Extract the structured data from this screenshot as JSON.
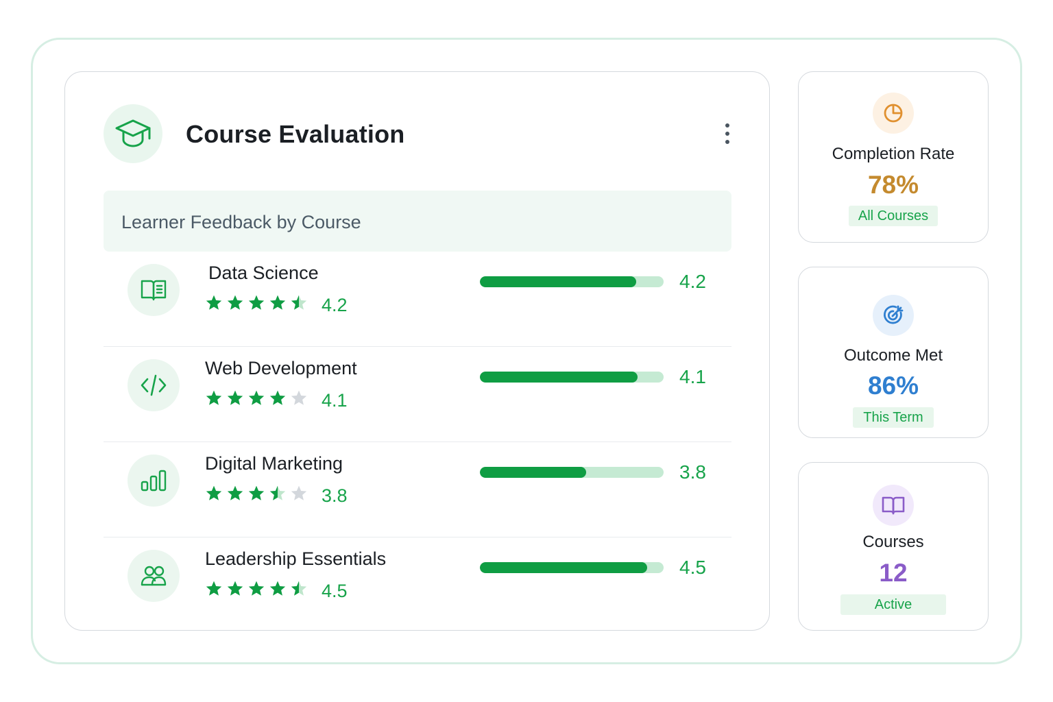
{
  "card": {
    "title": "Course Evaluation",
    "subheader": "Learner Feedback by Course"
  },
  "courses": [
    {
      "name": "Data Science",
      "rating_text": "4.2",
      "bar_text": "4.2",
      "rating": 4.2,
      "bar_fraction": 0.85,
      "icon": "book-open-icon"
    },
    {
      "name": "Web Development",
      "rating_text": "4.1",
      "bar_text": "4.1",
      "rating": 4.1,
      "bar_fraction": 0.86,
      "icon": "code-icon"
    },
    {
      "name": "Digital Marketing",
      "rating_text": "3.8",
      "bar_text": "3.8",
      "rating": 3.8,
      "bar_fraction": 0.58,
      "icon": "bar-chart-icon"
    },
    {
      "name": "Leadership Essentials",
      "rating_text": "4.5",
      "bar_text": "4.5",
      "rating": 4.5,
      "bar_fraction": 0.91,
      "icon": "users-icon"
    }
  ],
  "stars_shown": [
    4.5,
    4.0,
    3.5,
    4.5
  ],
  "stats": [
    {
      "title": "Completion Rate",
      "value": "78%",
      "badge": "All Courses",
      "color": "#c48a2e",
      "icon": "pie-chart-icon",
      "icon_bg": "#fdf1e3",
      "icon_color": "#e0902f"
    },
    {
      "title": "Outcome Met",
      "value": "86%",
      "badge": "This Term",
      "color": "#2f7fd0",
      "icon": "target-icon",
      "icon_bg": "#e6f0fb",
      "icon_color": "#2f7fd0"
    },
    {
      "title": "Courses",
      "value": "12",
      "badge": "Active",
      "color": "#8a5cc8",
      "icon": "book-icon",
      "icon_bg": "#f1e9fb",
      "icon_color": "#8a5cc8"
    }
  ],
  "colors": {
    "accent": "#0f9d43",
    "star_empty": "#d3d7dc"
  }
}
